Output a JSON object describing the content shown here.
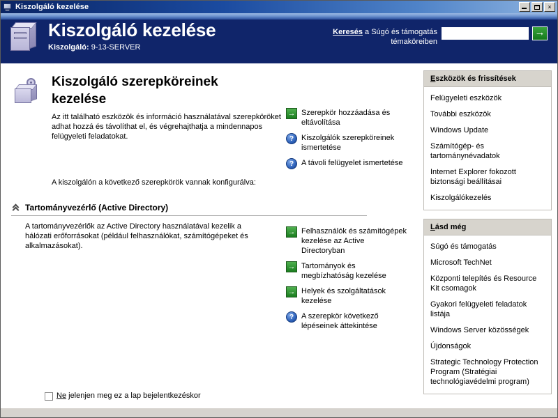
{
  "window": {
    "title": "Kiszolgáló kezelése",
    "icon": "server-monitor-icon",
    "buttons": {
      "minimize": "_",
      "maximize": "□",
      "close": "×"
    }
  },
  "banner": {
    "title": "Kiszolgáló kezelése",
    "subtitle_label": "Kiszolgáló:",
    "subtitle_value": "9-13-SERVER",
    "icon": "server-tower-icon",
    "search": {
      "label_bold": "Keresés",
      "label_rest": " a Súgó és támogatás témaköreiben",
      "value": "",
      "placeholder": "",
      "go_label": "→"
    }
  },
  "main": {
    "icon": "server-roles-icon",
    "page_title": "Kiszolgáló szerepköreinek kezelése",
    "intro_paragraph": "Az itt található eszközök és információ használatával szerepköröket adhat hozzá és távolíthat el, és végrehajthatja a mindennapos felügyeleti feladatokat.",
    "configured_line": "A kiszolgálón a következő szerepkörök vannak konfigurálva:",
    "top_links": [
      {
        "icon": "green-arrow-icon",
        "type": "arrow",
        "label": "Szerepkör hozzáadása és eltávolítása"
      },
      {
        "icon": "blue-help-icon",
        "type": "help",
        "label": "Kiszolgálók szerepköreinek ismertetése"
      },
      {
        "icon": "blue-help-icon",
        "type": "help",
        "label": "A távoli felügyelet ismertetése"
      }
    ],
    "role": {
      "collapse_icon": "chevron-up-double-icon",
      "title": "Tartományvezérlő (Active Directory)",
      "description": "A tartományvezérlők az Active Directory használatával kezelik a hálózati erőforrásokat (például felhasználókat, számítógépeket és alkalmazásokat).",
      "links": [
        {
          "icon": "green-arrow-icon",
          "type": "arrow",
          "label": "Felhasználók és számítógépek kezelése az Active Directoryban"
        },
        {
          "icon": "green-arrow-icon",
          "type": "arrow",
          "label": "Tartományok és megbízhatóság kezelése"
        },
        {
          "icon": "green-arrow-icon",
          "type": "arrow",
          "label": "Helyek és szolgáltatások kezelése"
        },
        {
          "icon": "blue-help-icon",
          "type": "help",
          "label": "A szerepkör következő lépéseinek áttekintése"
        }
      ]
    },
    "checkbox": {
      "checked": false,
      "label_underlined": "Ne",
      "label_rest": " jelenjen meg ez a lap bejelentkezéskor"
    }
  },
  "sidebar": {
    "panels": [
      {
        "header_underlined": "E",
        "header_rest": "szközök és frissítések",
        "links": [
          "Felügyeleti eszközök",
          "További eszközök",
          "Windows Update",
          "Számítógép- és tartománynévadatok",
          "Internet Explorer fokozott biztonsági beállításai",
          "Kiszolgálókezelés"
        ]
      },
      {
        "header_underlined": "L",
        "header_rest": "ásd még",
        "links": [
          "Súgó és támogatás",
          "Microsoft TechNet",
          "Központi telepítés és Resource Kit csomagok",
          "Gyakori felügyeleti feladatok listája",
          "Windows Server közösségek",
          "Újdonságok",
          "Strategic Technology Protection Program (Stratégiai technológiavédelmi program)"
        ]
      }
    ]
  },
  "colors": {
    "banner_navy": "#10256a",
    "titlebar_blue": "#0a2464",
    "panel_header_gray": "#d7d4cd",
    "accent_green": "#1a7d1f",
    "help_blue": "#2f63bb"
  }
}
